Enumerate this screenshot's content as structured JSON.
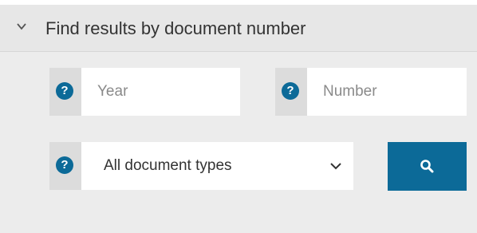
{
  "header": {
    "title": "Find results by document number"
  },
  "help": {
    "symbol": "?"
  },
  "fields": {
    "year_placeholder": "Year",
    "number_placeholder": "Number"
  },
  "doc_type": {
    "selected": "All document types"
  },
  "colors": {
    "accent": "#0c6a98",
    "panel_bg": "#ececec",
    "header_bg": "#e7e7e7",
    "help_bg": "#dcdcdc"
  },
  "icons": {
    "collapse": "chevron-down-icon",
    "help": "help-icon",
    "dropdown": "chevron-down-icon",
    "search": "search-icon"
  }
}
